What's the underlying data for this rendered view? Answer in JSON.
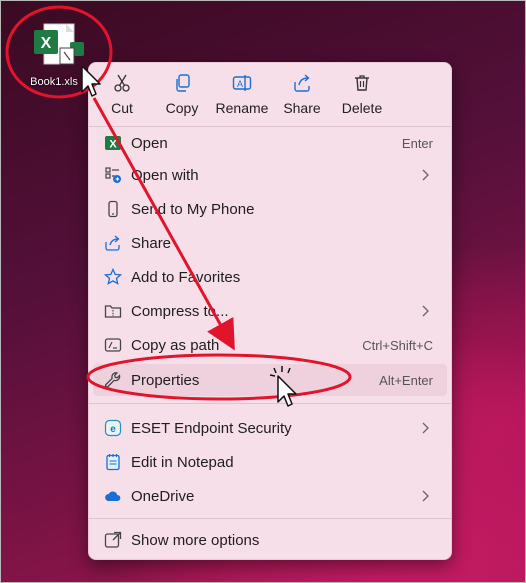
{
  "desktop": {
    "file_name": "Book1.xls"
  },
  "toolbar": [
    {
      "id": "cut",
      "label": "Cut"
    },
    {
      "id": "copy",
      "label": "Copy"
    },
    {
      "id": "rename",
      "label": "Rename"
    },
    {
      "id": "share",
      "label": "Share"
    },
    {
      "id": "delete",
      "label": "Delete"
    }
  ],
  "menu": {
    "open": {
      "label": "Open",
      "shortcut": "Enter"
    },
    "open_with": {
      "label": "Open with"
    },
    "send_to_phone": {
      "label": "Send to My Phone"
    },
    "share": {
      "label": "Share"
    },
    "add_favorites": {
      "label": "Add to Favorites"
    },
    "compress": {
      "label": "Compress to..."
    },
    "copy_path": {
      "label": "Copy as path",
      "shortcut": "Ctrl+Shift+C"
    },
    "properties": {
      "label": "Properties",
      "shortcut": "Alt+Enter"
    },
    "eset": {
      "label": "ESET Endpoint Security"
    },
    "notepad": {
      "label": "Edit in Notepad"
    },
    "onedrive": {
      "label": "OneDrive"
    },
    "more_options": {
      "label": "Show more options"
    }
  },
  "colors": {
    "annotation_red": "#e0142a",
    "excel_green": "#1f7a44",
    "menu_bg": "#f6dfe9",
    "onedrive_blue": "#1a6fd4"
  }
}
